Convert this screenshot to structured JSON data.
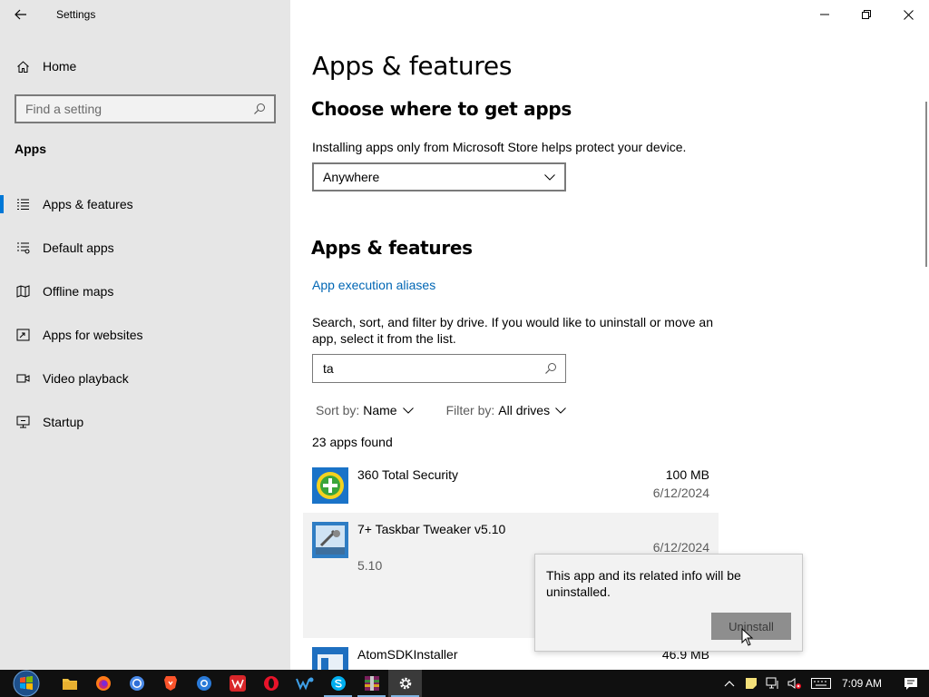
{
  "window": {
    "app_title": "Settings"
  },
  "sidebar": {
    "home_label": "Home",
    "search_placeholder": "Find a setting",
    "section_title": "Apps",
    "items": [
      {
        "label": "Apps & features",
        "icon": "apps-list-icon",
        "selected": true
      },
      {
        "label": "Default apps",
        "icon": "default-apps-icon"
      },
      {
        "label": "Offline maps",
        "icon": "map-icon"
      },
      {
        "label": "Apps for websites",
        "icon": "open-external-icon"
      },
      {
        "label": "Video playback",
        "icon": "video-icon"
      },
      {
        "label": "Startup",
        "icon": "startup-icon"
      }
    ]
  },
  "main": {
    "page_title": "Apps & features",
    "choose_heading": "Choose where to get apps",
    "choose_desc": "Installing apps only from Microsoft Store helps protect your device.",
    "source_dropdown": "Anywhere",
    "apps_heading": "Apps & features",
    "aliases_link": "App execution aliases",
    "search_desc": "Search, sort, and filter by drive. If you would like to uninstall or move an app, select it from the list.",
    "filter_value": "ta",
    "sort_label": "Sort by:",
    "sort_value": "Name",
    "filter_label": "Filter by:",
    "filter_by_value": "All drives",
    "found_text": "23 apps found",
    "apps": [
      {
        "name": "360 Total Security",
        "size": "100 MB",
        "date": "6/12/2024"
      },
      {
        "name": "7+ Taskbar Tweaker v5.10",
        "size": "",
        "date": "6/12/2024",
        "version": "5.10"
      },
      {
        "name": "AtomSDKInstaller",
        "size": "46.9 MB",
        "date": ""
      }
    ]
  },
  "flyout": {
    "message": "This app and its related info will be uninstalled.",
    "button": "Uninstall"
  },
  "taskbar": {
    "apps": [
      "file-explorer-icon",
      "firefox-icon",
      "chrome-icon",
      "brave-icon",
      "browser-icon",
      "wps-icon",
      "opera-icon",
      "app-icon",
      "skype-icon",
      "winrar-icon",
      "settings-icon"
    ],
    "clock": "7:09 AM"
  },
  "colors": {
    "accent": "#0078d7",
    "link": "#0066b4",
    "sidebar_bg": "#e6e6e6"
  }
}
